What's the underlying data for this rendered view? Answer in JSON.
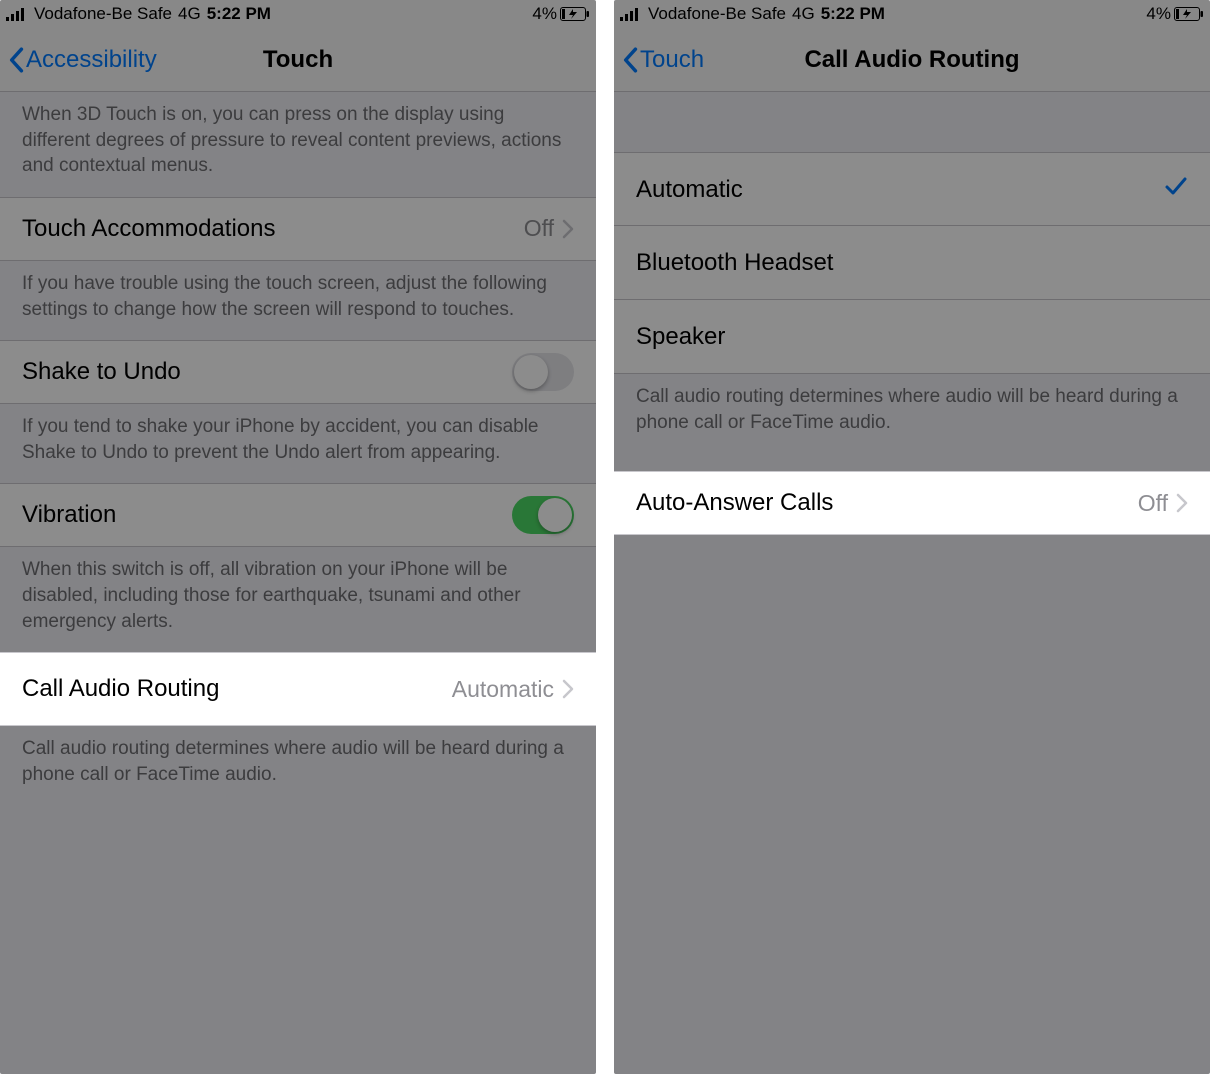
{
  "status": {
    "carrier": "Vodafone-Be Safe",
    "network": "4G",
    "time": "5:22 PM",
    "battery_pct": "4%"
  },
  "left": {
    "nav": {
      "back": "Accessibility",
      "title": "Touch"
    },
    "touch3d_footer": "When 3D Touch is on, you can press on the display using different degrees of pressure to reveal content previews, actions and contextual menus.",
    "touch_accommodations": {
      "label": "Touch Accommodations",
      "value": "Off"
    },
    "touch_accommodations_footer": "If you have trouble using the touch screen, adjust the following settings to change how the screen will respond to touches.",
    "shake_to_undo": {
      "label": "Shake to Undo"
    },
    "shake_footer": "If you tend to shake your iPhone by accident, you can disable Shake to Undo to prevent the Undo alert from appearing.",
    "vibration": {
      "label": "Vibration"
    },
    "vibration_footer": "When this switch is off, all vibration on your iPhone will be disabled, including those for earthquake, tsunami and other emergency alerts.",
    "call_audio_routing": {
      "label": "Call Audio Routing",
      "value": "Automatic"
    },
    "call_audio_footer": "Call audio routing determines where audio will be heard during a phone call or FaceTime audio."
  },
  "right": {
    "nav": {
      "back": "Touch",
      "title": "Call Audio Routing"
    },
    "options": {
      "automatic": "Automatic",
      "bluetooth": "Bluetooth Headset",
      "speaker": "Speaker"
    },
    "options_footer": "Call audio routing determines where audio will be heard during a phone call or FaceTime audio.",
    "auto_answer": {
      "label": "Auto-Answer Calls",
      "value": "Off"
    }
  }
}
